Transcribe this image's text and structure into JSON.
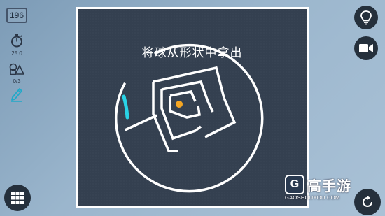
{
  "hud": {
    "level": "196",
    "timer_value": "25.0",
    "shapes_value": "0/3"
  },
  "board": {
    "instruction": "将球从形状中拿出"
  },
  "watermark": {
    "logo": "G",
    "name": "高手游",
    "url": "GAOSHOUYOU.COM"
  },
  "colors": {
    "board_background": "#344050",
    "maze_lines": "#ffffff",
    "ball": "#f5a623",
    "drawn_stroke": "#29d3e6",
    "button_dark": "#25303c"
  },
  "icons": {
    "timer": "stopwatch-icon",
    "shapes": "shapes-icon",
    "pen": "pen-icon",
    "hint": "lightbulb-icon",
    "video": "video-camera-icon",
    "menu": "grid-menu-icon",
    "restart": "restart-icon"
  }
}
